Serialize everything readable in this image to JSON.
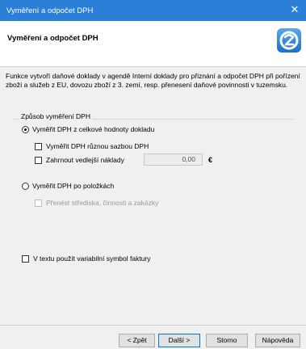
{
  "window": {
    "title": "Vyměření a odpočet DPH",
    "close_glyph": "✕"
  },
  "header": {
    "title": "Vyměření a odpočet DPH",
    "logo_icon": "pohoda-logo-icon"
  },
  "description": "Funkce vytvoří daňové doklady v agendě Interní doklady pro přiznání a odpočet DPH při pořízení zboží a služeb z EU, dovozu zboží z 3. zemí, resp. přenesení daňové povinnosti v tuzemsku.",
  "group": {
    "label": "Způsob vyměření DPH",
    "option_total": {
      "label": "Vyměřit DPH z celkové hodnoty dokladu",
      "selected": true
    },
    "check_various_rate": {
      "label": "Vyměřit DPH různou sazbou DPH",
      "checked": false
    },
    "check_side_costs": {
      "label": "Zahrnout vedlejší náklady",
      "checked": false
    },
    "side_costs_value": "0,00",
    "currency": "€",
    "option_items": {
      "label": "Vyměřit DPH po položkách",
      "selected": false
    },
    "check_transfer_centers": {
      "label": "Přenést střediska, činnosti a zakázky",
      "checked": false
    }
  },
  "check_variable_symbol": {
    "label": "V textu použít variabilní symbol faktury",
    "checked": false
  },
  "buttons": {
    "back": "< Zpět",
    "next": "Další >",
    "cancel": "Storno",
    "help": "Nápověda"
  },
  "colors": {
    "titlebar": "#2b7fd6",
    "accent": "#0078d7"
  }
}
